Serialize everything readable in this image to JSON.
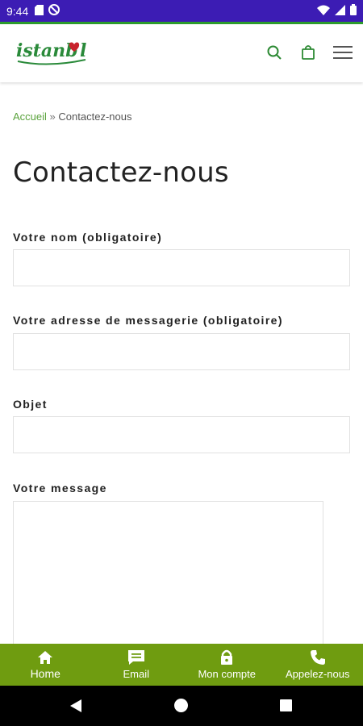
{
  "status_bar": {
    "time": "9:44",
    "left_icons": [
      "sd-card-icon",
      "no-sync-icon"
    ],
    "right_icons": [
      "wifi-icon",
      "signal-icon",
      "battery-icon"
    ],
    "background": "#3c1cb4"
  },
  "header": {
    "logo_text": "istanbul",
    "icons": [
      "search-icon",
      "shopping-bag-icon",
      "menu-icon"
    ],
    "accent": "#2d8a34"
  },
  "breadcrumb": {
    "home": "Accueil",
    "separator": "»",
    "current": "Contactez-nous"
  },
  "page": {
    "title": "Contactez-nous"
  },
  "form": {
    "name_label": "Votre nom (obligatoire)",
    "name_value": "",
    "email_label": "Votre adresse de messagerie (obligatoire)",
    "email_value": "",
    "subject_label": "Objet",
    "subject_value": "",
    "message_label": "Votre message",
    "message_value": ""
  },
  "bottom_nav": {
    "background": "#6f9c10",
    "items": [
      {
        "label": "Home",
        "icon": "home-icon"
      },
      {
        "label": "Email",
        "icon": "email-icon"
      },
      {
        "label": "Mon compte",
        "icon": "lock-icon"
      },
      {
        "label": "Appelez-nous",
        "icon": "phone-icon"
      }
    ]
  },
  "system_nav": {
    "buttons": [
      "back-icon",
      "home-circle-icon",
      "recents-icon"
    ]
  }
}
